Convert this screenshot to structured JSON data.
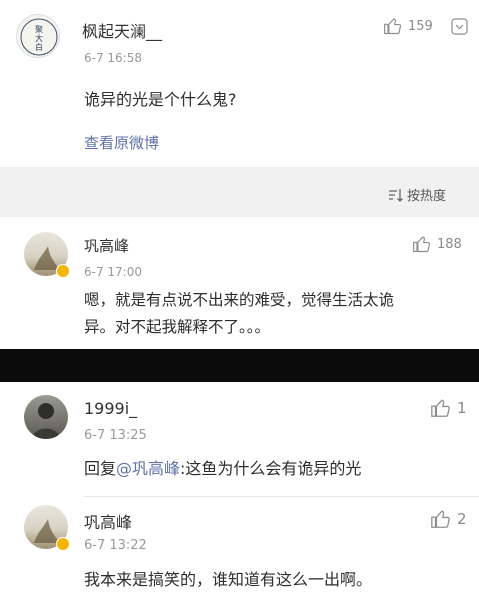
{
  "post": {
    "author": "枫起天澜__",
    "avatar_text": "聚\n大\n白",
    "time": "6-7 16:58",
    "likes": "159",
    "text": "诡异的光是个什么鬼?",
    "view_original": "查看原微博"
  },
  "sort": {
    "label": "按热度"
  },
  "comments_top": [
    {
      "author": "巩高峰",
      "time": "6-7 17:00",
      "likes": "188",
      "text_line1": "嗯，就是有点说不出来的难受，觉得生活太诡",
      "text_line2": "异。对不起我解释不了。。。"
    }
  ],
  "comments_bottom": [
    {
      "author": "1999i_",
      "time": "6-7 13:25",
      "likes": "1",
      "reply_prefix": "回复",
      "mention": "@巩高峰",
      "text": ":这鱼为什么会有诡异的光"
    },
    {
      "author": "巩高峰",
      "time": "6-7 13:22",
      "likes": "2",
      "text": "我本来是搞笑的，谁知道有这么一出啊。"
    }
  ],
  "colors": {
    "link": "#5f72a8",
    "band": "#f1f1f1",
    "black_band": "#0b0b0b"
  }
}
